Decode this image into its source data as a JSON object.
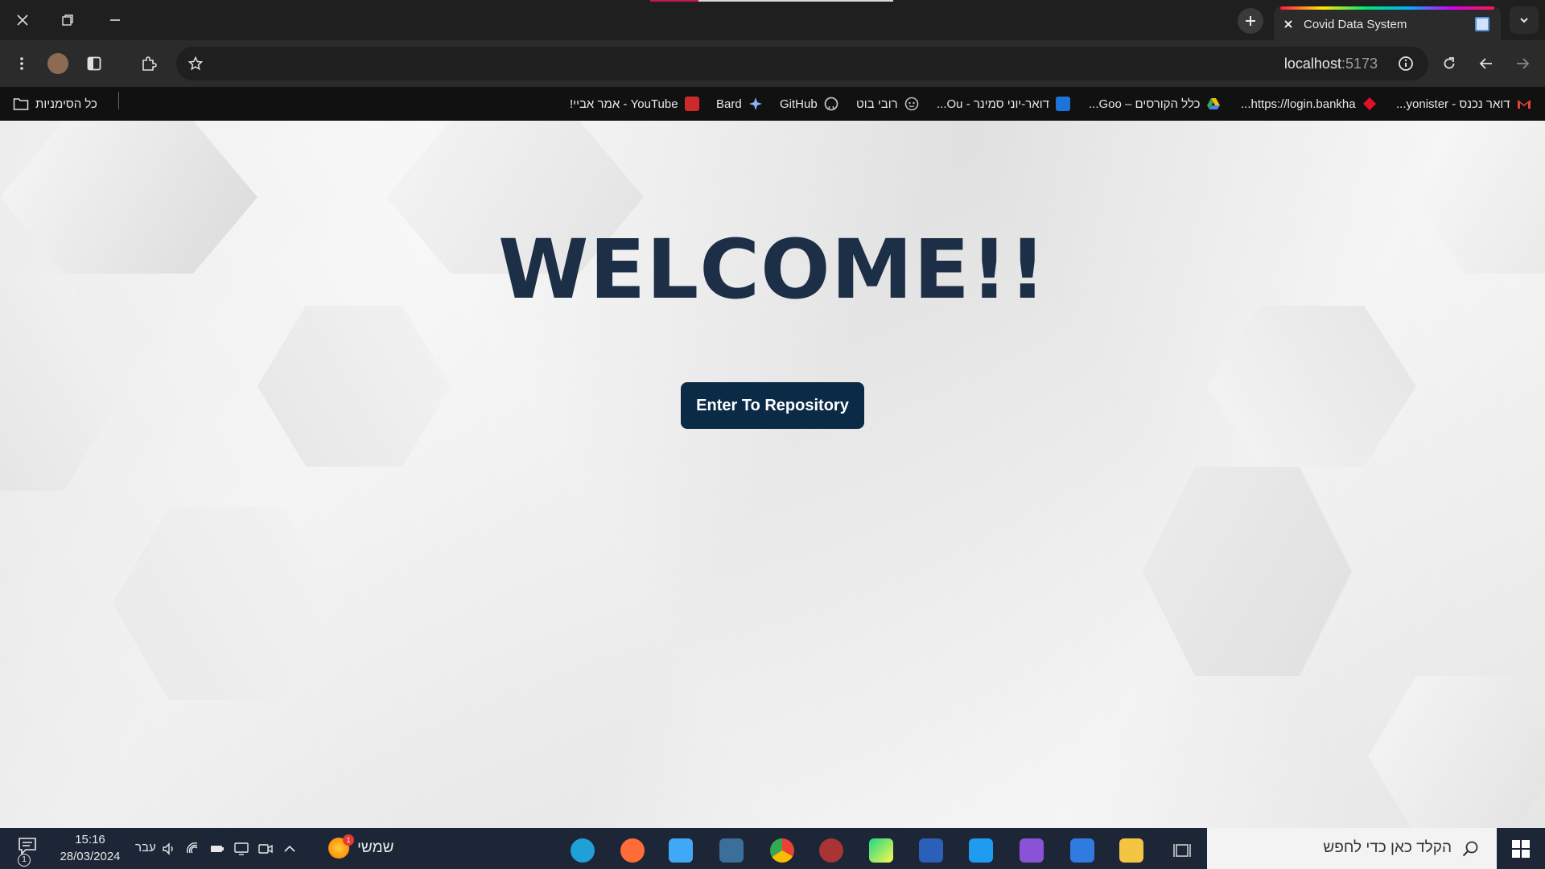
{
  "browser": {
    "tab_title": "Covid Data System",
    "url_host": "localhost",
    "url_port": ":5173"
  },
  "bookmarks": {
    "all_bookmarks": "כל הסימניות",
    "items": [
      {
        "label": "YouTube - אמר אביי!",
        "icon": "youtube-icon",
        "color": "#cc2a2a"
      },
      {
        "label": "Bard",
        "icon": "bard-sparkle-icon",
        "color": "#8ab4f8"
      },
      {
        "label": "GitHub",
        "icon": "github-icon",
        "color": "#bbbbbb"
      },
      {
        "label": "רובי בוט",
        "icon": "robot-icon",
        "color": "#bbbbbb"
      },
      {
        "label": "דואר-יוני סמינר - Ou...",
        "icon": "outlook-icon",
        "color": "#1e73d8"
      },
      {
        "label": "כלל הקורסים – Goo...",
        "icon": "google-drive-icon",
        "color": "#34a853"
      },
      {
        "label": "https://login.bankha...",
        "icon": "bank-diamond-icon",
        "color": "#e0102a"
      },
      {
        "label": "דואר נכנס - yonister...",
        "icon": "gmail-icon",
        "color": "#ea4335"
      }
    ]
  },
  "page": {
    "heading": "WELCOME!!",
    "button_label": "Enter To Repository"
  },
  "taskbar": {
    "search_placeholder": "הקלד כאן כדי לחפש",
    "weather_text": "שמשי",
    "weather_badge": "1",
    "language": "עבר",
    "time": "15:16",
    "date": "28/03/2024",
    "notification_count": "1",
    "apps": [
      {
        "name": "edge-icon",
        "color": "#1fa0d6"
      },
      {
        "name": "postman-icon",
        "color": "#ff6c37"
      },
      {
        "name": "media-player-icon",
        "color": "#3fa9f5"
      },
      {
        "name": "mysql-workbench-icon",
        "color": "#3a6f9a"
      },
      {
        "name": "chrome-icon",
        "color": "#e8453c"
      },
      {
        "name": "app-face-icon",
        "color": "#a33"
      },
      {
        "name": "pycharm-icon",
        "color": "#21d789"
      },
      {
        "name": "word-icon",
        "color": "#2b5fb8"
      },
      {
        "name": "vscode-icon",
        "color": "#1f9cf0"
      },
      {
        "name": "visual-studio-icon",
        "color": "#8a52d6"
      },
      {
        "name": "todo-icon",
        "color": "#2f7be0"
      },
      {
        "name": "file-explorer-icon",
        "color": "#f4c542"
      },
      {
        "name": "task-view-icon",
        "color": "#cccccc"
      }
    ]
  }
}
